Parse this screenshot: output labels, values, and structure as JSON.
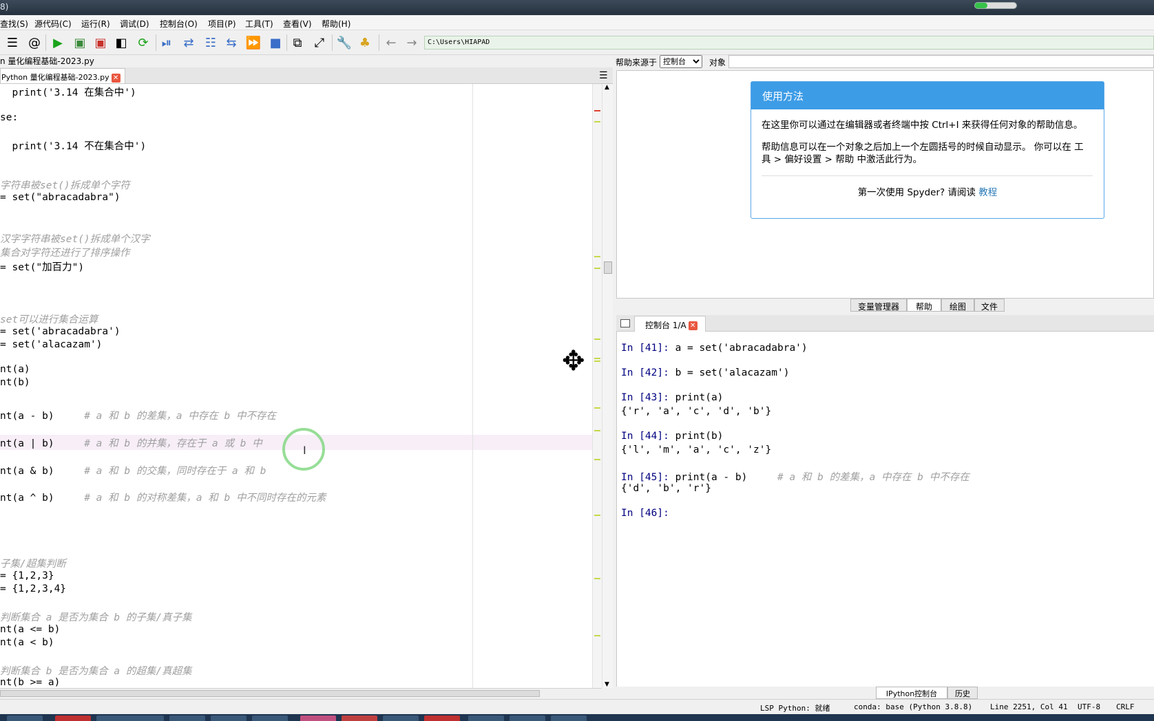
{
  "titlebar": {
    "title_fragment": "8)"
  },
  "menu": [
    "查找(S)",
    "源代码(C)",
    "运行(R)",
    "调试(D)",
    "控制台(O)",
    "项目(P)",
    "工具(T)",
    "查看(V)",
    "帮助(H)"
  ],
  "toolbar": {
    "path": "C:\\Users\\HIAPAD",
    "icons": [
      "list-icon",
      "at-icon",
      "run-icon",
      "run-cell-icon",
      "run-cell-advance-icon",
      "run-selection-icon",
      "rerun-icon",
      "debug-icon",
      "step-icon",
      "step-into-icon",
      "step-return-icon",
      "continue-icon",
      "stop-icon",
      "maximize-pane-icon",
      "fullscreen-icon",
      "preferences-icon",
      "python-path-icon",
      "back-icon",
      "forward-icon"
    ]
  },
  "editor": {
    "file_title": "n 量化编程基础-2023.py",
    "tab_label": "Python 量化编程基础-2023.py",
    "lines": [
      {
        "code": "  print('3.14 在集合中')",
        "comment": ""
      },
      {
        "code": "se:",
        "comment": ""
      },
      {
        "code": "  print('3.14 不在集合中')",
        "comment": ""
      },
      {
        "code": "",
        "comment": "字符串被set()拆成单个字符"
      },
      {
        "code": "= set(\"abracadabra\")",
        "comment": ""
      },
      {
        "code": "",
        "comment": "汉字字符串被set()拆成单个汉字"
      },
      {
        "code": "",
        "comment": "集合对字符还进行了排序操作"
      },
      {
        "code": "= set(\"加百力\")",
        "comment": ""
      },
      {
        "code": "",
        "comment": "set可以进行集合运算"
      },
      {
        "code": "= set('abracadabra')",
        "comment": ""
      },
      {
        "code": "= set('alacazam')",
        "comment": ""
      },
      {
        "code": "nt(a)",
        "comment": ""
      },
      {
        "code": "nt(b)",
        "comment": ""
      },
      {
        "code": "nt(a - b)     ",
        "comment": "# a 和 b 的差集，a 中存在 b 中不存在"
      },
      {
        "code": "nt(a | b)     ",
        "comment": "# a 和 b 的并集，存在于 a 或 b 中"
      },
      {
        "code": "nt(a & b)     ",
        "comment": "# a 和 b 的交集，同时存在于 a 和 b"
      },
      {
        "code": "nt(a ^ b)     ",
        "comment": "# a 和 b 的对称差集，a 和 b 中不同时存在的元素"
      },
      {
        "code": "",
        "comment": "子集/超集判断"
      },
      {
        "code": "= {1,2,3}",
        "comment": ""
      },
      {
        "code": "= {1,2,3,4}",
        "comment": ""
      },
      {
        "code": "",
        "comment": "判断集合 a 是否为集合 b 的子集/真子集"
      },
      {
        "code": "nt(a <= b)",
        "comment": ""
      },
      {
        "code": "nt(a < b)",
        "comment": ""
      },
      {
        "code": "",
        "comment": "判断集合 b 是否为集合 a 的超集/真超集"
      },
      {
        "code": "nt(b >= a)",
        "comment": ""
      }
    ]
  },
  "help": {
    "source_label": "帮助来源于",
    "source_value": "控制台",
    "object_label": "对象",
    "card_title": "使用方法",
    "para1": "在这里你可以通过在编辑器或者终端中按 Ctrl+I 来获得任何对象的帮助信息。",
    "para2": "帮助信息可以在一个对象之后加上一个左圆括号的时候自动显示。 你可以在 工具 > 偏好设置 > 帮助 中激活此行为。",
    "foot_text": "第一次使用 Spyder? 请阅读",
    "foot_link": "教程"
  },
  "pane_tabs": [
    "变量管理器",
    "帮助",
    "绘图",
    "文件"
  ],
  "pane_tabs_active": "帮助",
  "console": {
    "tab_label": "控制台 1/A",
    "lines": [
      {
        "prompt": "In [41]: ",
        "code": "a = set('abracadabra')",
        "comment": ""
      },
      {
        "prompt": "In [42]: ",
        "code": "b = set('alacazam')",
        "comment": ""
      },
      {
        "prompt": "In [43]: ",
        "code": "print(a)",
        "comment": ""
      },
      {
        "prompt": "",
        "code": "{'r', 'a', 'c', 'd', 'b'}",
        "comment": ""
      },
      {
        "prompt": "In [44]: ",
        "code": "print(b)",
        "comment": ""
      },
      {
        "prompt": "",
        "code": "{'l', 'm', 'a', 'c', 'z'}",
        "comment": ""
      },
      {
        "prompt": "In [45]: ",
        "code": "print(a - b)     ",
        "comment": "# a 和 b 的差集，a 中存在 b 中不存在"
      },
      {
        "prompt": "",
        "code": "{'d', 'b', 'r'}",
        "comment": ""
      },
      {
        "prompt": "In [46]: ",
        "code": "",
        "comment": ""
      }
    ]
  },
  "bottom_tabs": [
    "IPython控制台",
    "历史"
  ],
  "status": {
    "lsp": "LSP Python: 就绪",
    "conda": "conda: base (Python 3.8.8)",
    "position": "Line 2251, Col 41",
    "encoding": "UTF-8",
    "eol": "CRLF"
  }
}
